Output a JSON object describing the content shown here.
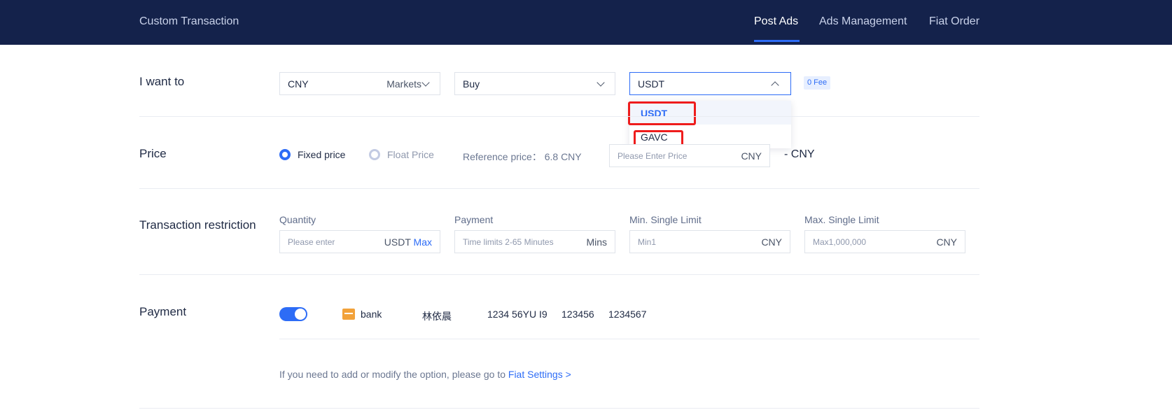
{
  "header": {
    "title": "Custom Transaction",
    "nav": [
      {
        "label": "Post Ads",
        "active": true
      },
      {
        "label": "Ads Management",
        "active": false
      },
      {
        "label": "Fiat Order",
        "active": false
      }
    ]
  },
  "want": {
    "label": "I want to",
    "currency_value": "CNY",
    "markets_label": "Markets",
    "side_value": "Buy",
    "coin_value": "USDT",
    "fee_badge": "0 Fee",
    "coin_options": [
      "USDT",
      "GAVC"
    ]
  },
  "price": {
    "label": "Price",
    "fixed_label": "Fixed price",
    "float_label": "Float Price",
    "reference": "Reference price： 6.8 CNY",
    "placeholder": "Please Enter Price",
    "unit": "CNY",
    "result": "- CNY"
  },
  "restriction": {
    "label": "Transaction restriction",
    "quantity": {
      "label": "Quantity",
      "placeholder": "Please enter",
      "unit": "USDT",
      "max": "Max"
    },
    "payment": {
      "label": "Payment",
      "placeholder": "Time limits 2-65 Minutes",
      "unit": "Mins"
    },
    "min_limit": {
      "label": "Min. Single Limit",
      "placeholder": "Min1",
      "unit": "CNY"
    },
    "max_limit": {
      "label": "Max. Single Limit",
      "placeholder": "Max1,000,000",
      "unit": "CNY"
    }
  },
  "payment": {
    "label": "Payment",
    "enabled": true,
    "method": "bank",
    "name": "林依晨",
    "account": "1234 56YU I9",
    "field2": "123456",
    "field3": "1234567",
    "note_prefix": "If you need to add or modify the option, please go to",
    "note_link": "Fiat Settings >"
  },
  "colors": {
    "header_bg": "#14224b",
    "accent": "#2d6cf6",
    "highlight": "#ee1c1c"
  }
}
